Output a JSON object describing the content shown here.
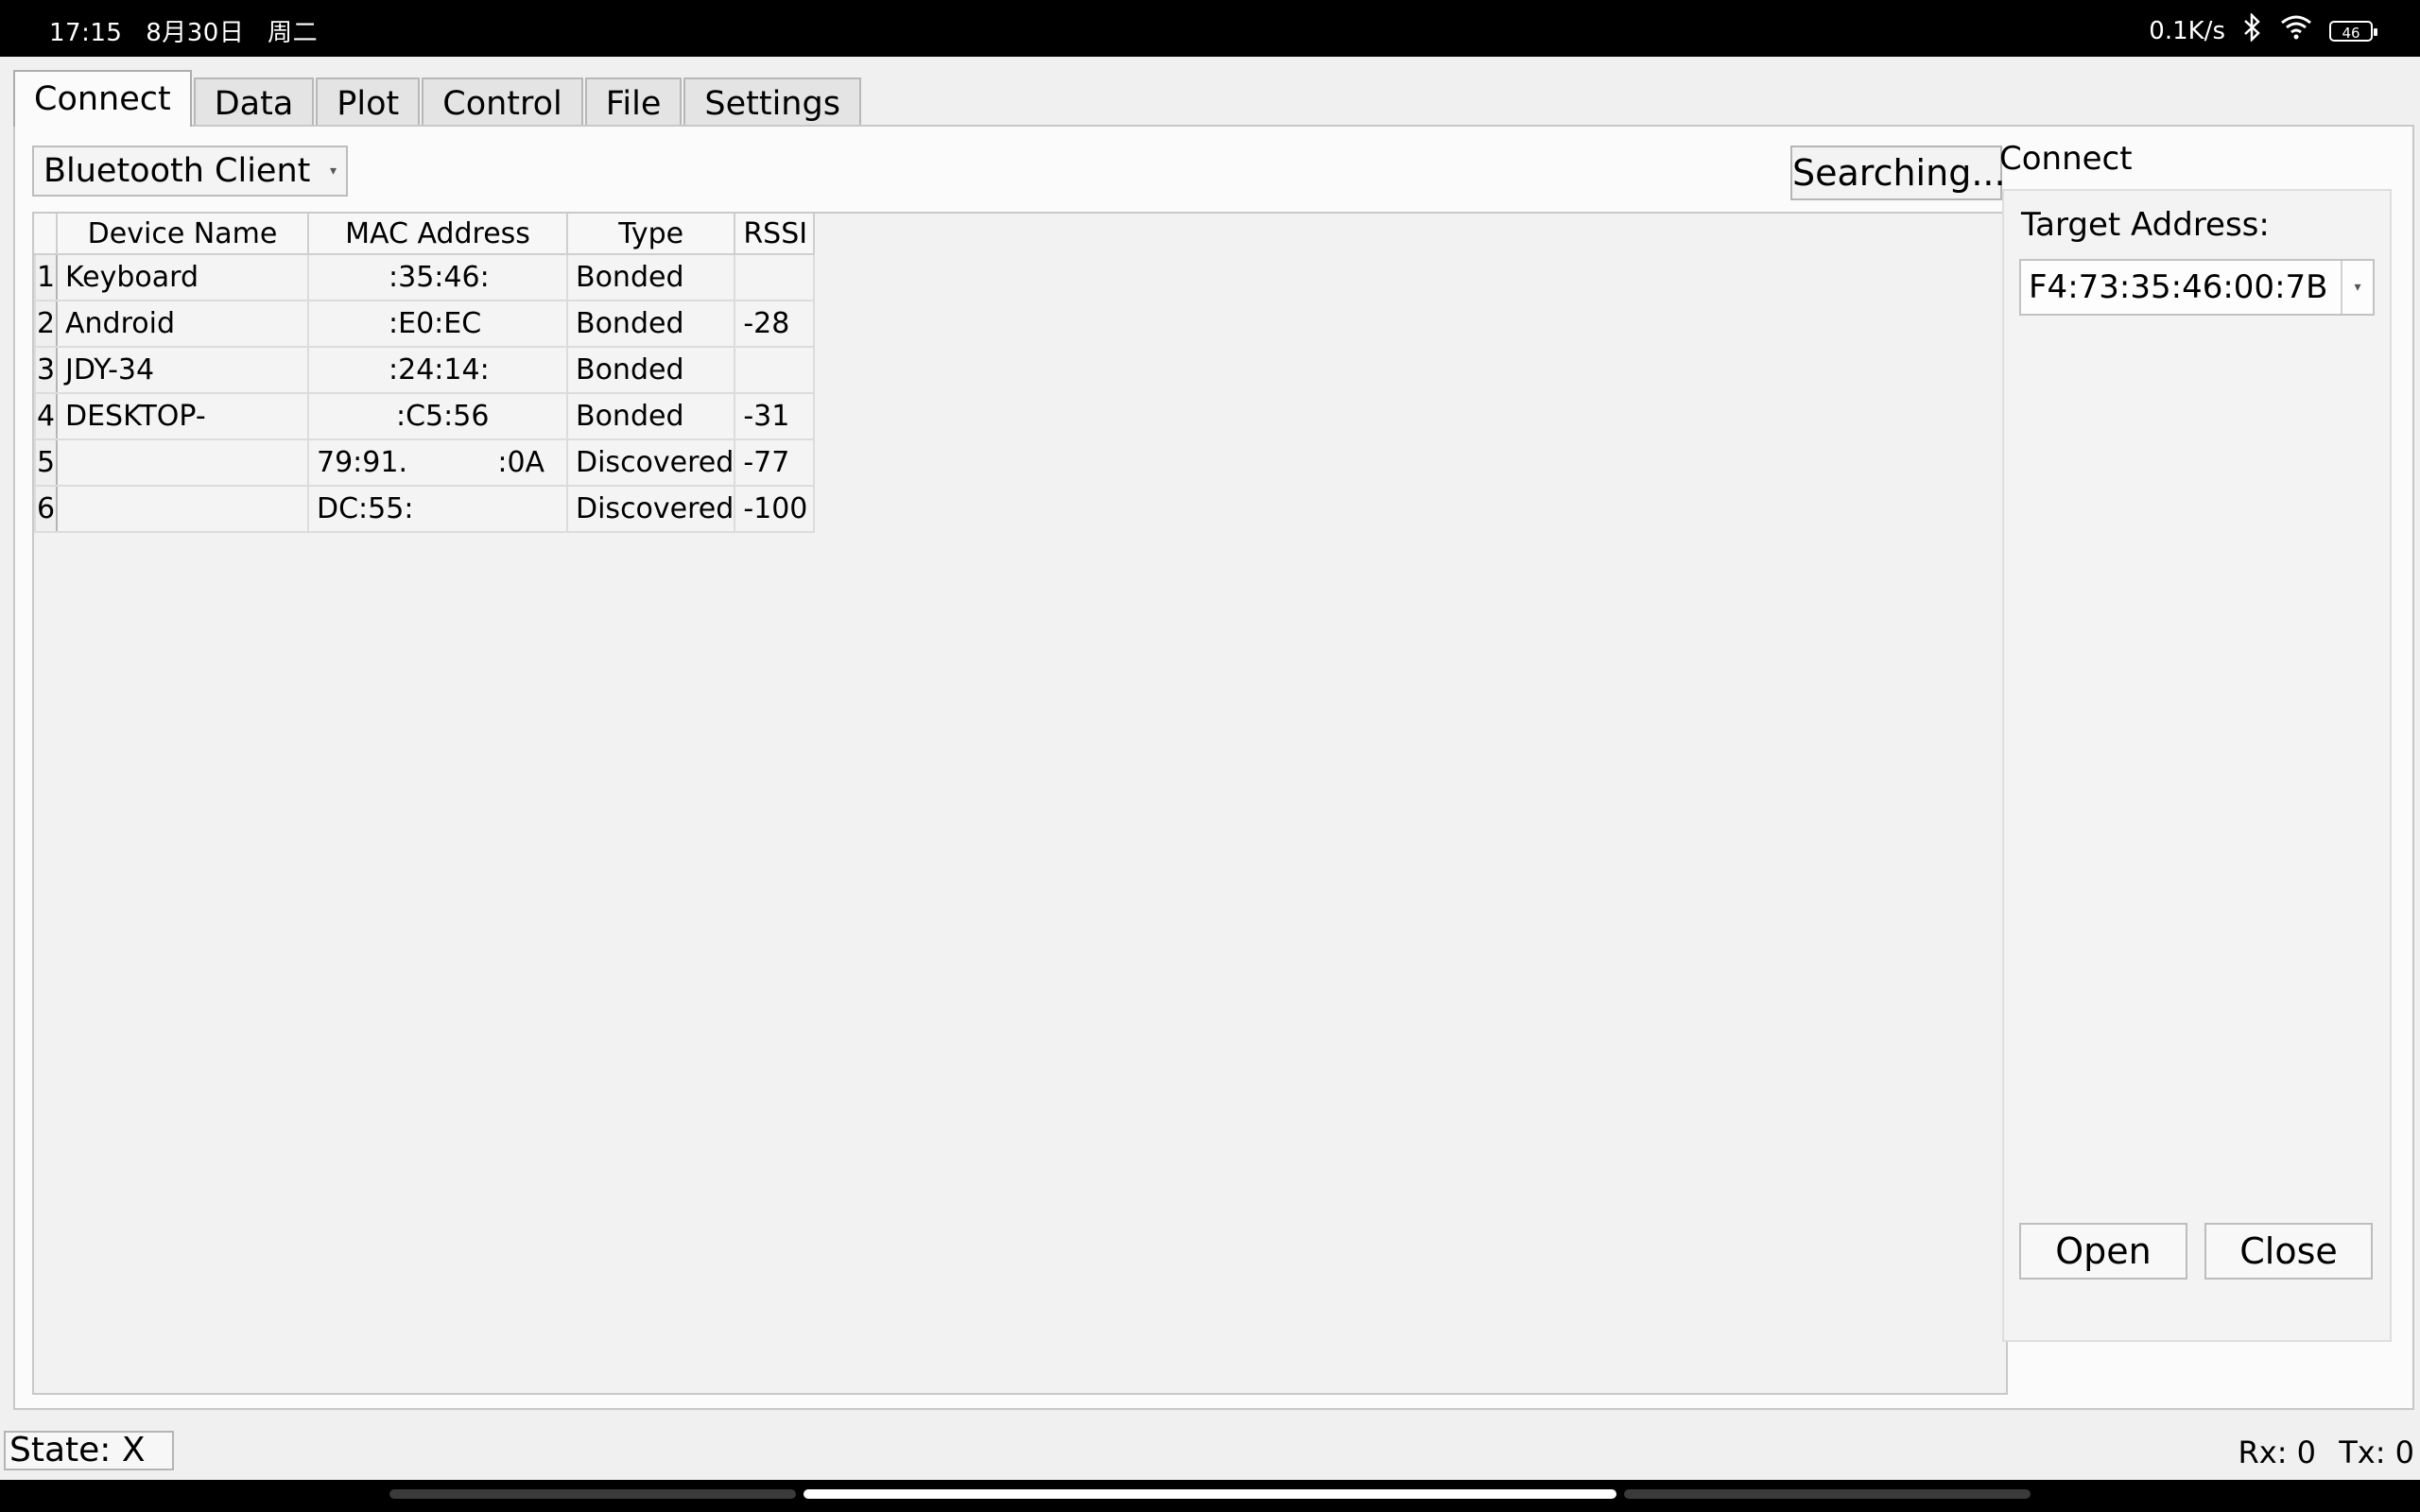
{
  "status_bar": {
    "time": "17:15",
    "date": "8月30日",
    "weekday": "周二",
    "net_speed": "0.1K/s",
    "battery": "46",
    "icons": [
      "bluetooth-icon",
      "wifi-icon",
      "battery-icon"
    ]
  },
  "tabs": [
    {
      "label": "Connect",
      "active": true
    },
    {
      "label": "Data"
    },
    {
      "label": "Plot"
    },
    {
      "label": "Control"
    },
    {
      "label": "File"
    },
    {
      "label": "Settings"
    }
  ],
  "connection_mode": {
    "selected": "Bluetooth Client"
  },
  "search_button": {
    "label": "Searching..."
  },
  "device_table": {
    "headers": [
      "Device Name",
      "MAC Address",
      "Type",
      "RSSI"
    ],
    "rows": [
      {
        "index": "1",
        "name": "Keyboard",
        "mac": ":35:46:",
        "type": "Bonded",
        "rssi": ""
      },
      {
        "index": "2",
        "name": "Android",
        "mac": ":E0:EC",
        "type": "Bonded",
        "rssi": "-28"
      },
      {
        "index": "3",
        "name": "JDY-34",
        "mac": ":24:14:",
        "type": "Bonded",
        "rssi": ""
      },
      {
        "index": "4",
        "name": "DESKTOP-",
        "mac": ":C5:56",
        "type": "Bonded",
        "rssi": "-31"
      },
      {
        "index": "5",
        "name": "",
        "mac": "79:91.          :0A",
        "type": "Discovered",
        "rssi": "-77"
      },
      {
        "index": "6",
        "name": "",
        "mac": "DC:55:",
        "type": "Discovered",
        "rssi": "-100"
      }
    ]
  },
  "connect_panel": {
    "title": "Connect",
    "target_label": "Target Address:",
    "target_value": "F4:73:35:46:00:7B",
    "open_label": "Open",
    "close_label": "Close"
  },
  "footer": {
    "state": "State: X",
    "rx": "Rx: 0",
    "tx": "Tx: 0"
  }
}
